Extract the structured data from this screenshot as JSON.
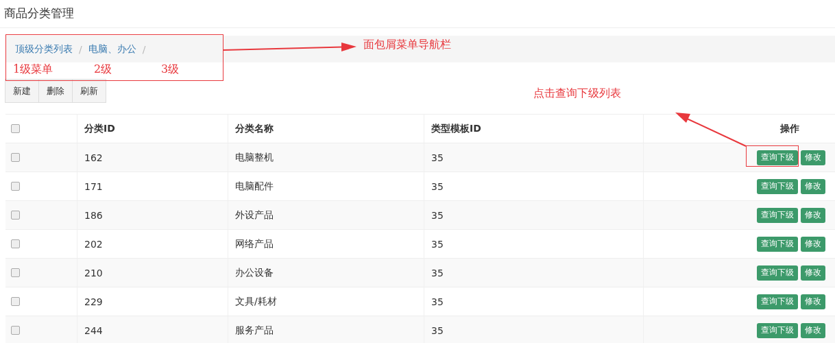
{
  "page_title": "商品分类管理",
  "breadcrumb": [
    {
      "label": "顶级分类列表",
      "separator": "/"
    },
    {
      "label": "电脑、办公",
      "separator": "/"
    }
  ],
  "toolbar": [
    "新建",
    "删除",
    "刷新"
  ],
  "table": {
    "select_all": {
      "checked": false
    },
    "columns": [
      "分类ID",
      "分类名称",
      "类型模板ID",
      "操作"
    ],
    "rows": [
      {
        "checked": false,
        "id": "162",
        "name": "电脑整机",
        "template_id": "35",
        "actions": [
          "查询下级",
          "修改"
        ]
      },
      {
        "checked": false,
        "id": "171",
        "name": "电脑配件",
        "template_id": "35",
        "actions": [
          "查询下级",
          "修改"
        ]
      },
      {
        "checked": false,
        "id": "186",
        "name": "外设产品",
        "template_id": "35",
        "actions": [
          "查询下级",
          "修改"
        ]
      },
      {
        "checked": false,
        "id": "202",
        "name": "网络产品",
        "template_id": "35",
        "actions": [
          "查询下级",
          "修改"
        ]
      },
      {
        "checked": false,
        "id": "210",
        "name": "办公设备",
        "template_id": "35",
        "actions": [
          "查询下级",
          "修改"
        ]
      },
      {
        "checked": false,
        "id": "229",
        "name": "文具/耗材",
        "template_id": "35",
        "actions": [
          "查询下级",
          "修改"
        ]
      },
      {
        "checked": false,
        "id": "244",
        "name": "服务产品",
        "template_id": "35",
        "actions": [
          "查询下级",
          "修改"
        ]
      }
    ]
  },
  "annotations": {
    "level_labels": [
      "1级菜单",
      "2级",
      "3级"
    ],
    "breadcrumb_note": "面包屑菜单导航栏",
    "query_note": "点击查询下级列表"
  }
}
